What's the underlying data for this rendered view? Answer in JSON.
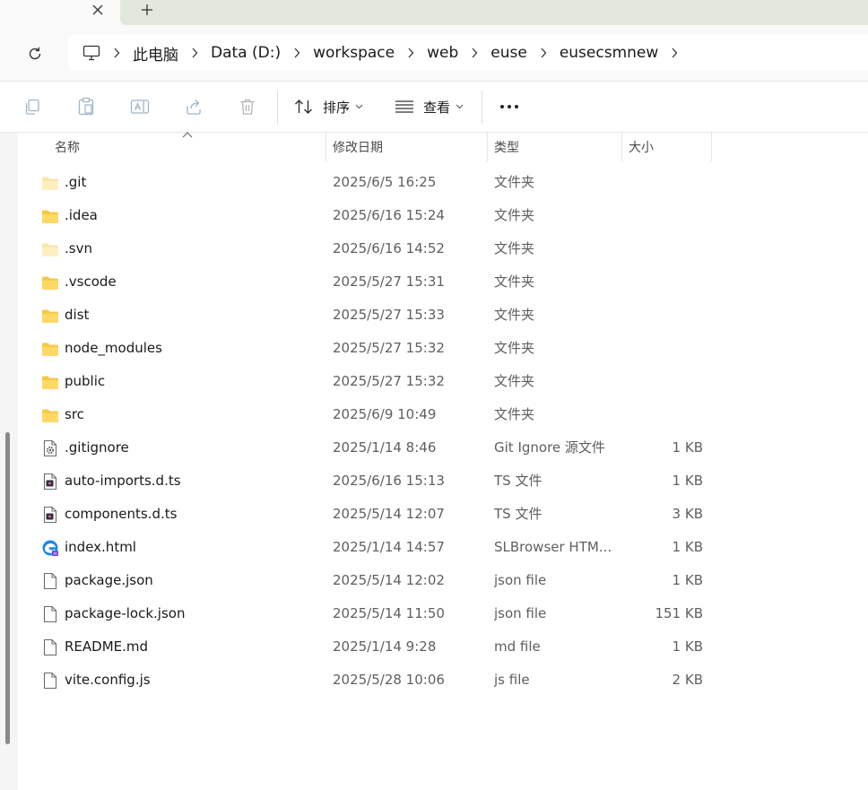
{
  "tabs": {
    "close_glyph": "✕",
    "new_glyph": "+"
  },
  "address": {
    "crumbs": [
      "此电脑",
      "Data (D:)",
      "workspace",
      "web",
      "euse",
      "eusecsmnew"
    ]
  },
  "toolbar": {
    "sort_label": "排序",
    "view_label": "查看",
    "more_glyph": "···"
  },
  "columns": {
    "name": "名称",
    "modified": "修改日期",
    "type": "类型",
    "size": "大小"
  },
  "files": [
    {
      "name": ".git",
      "modified": "2025/6/5 16:25",
      "type": "文件夹",
      "size": "",
      "icon": "folder-faded-icon"
    },
    {
      "name": ".idea",
      "modified": "2025/6/16 15:24",
      "type": "文件夹",
      "size": "",
      "icon": "folder-icon"
    },
    {
      "name": ".svn",
      "modified": "2025/6/16 14:52",
      "type": "文件夹",
      "size": "",
      "icon": "folder-faded-icon"
    },
    {
      "name": ".vscode",
      "modified": "2025/5/27 15:31",
      "type": "文件夹",
      "size": "",
      "icon": "folder-icon"
    },
    {
      "name": "dist",
      "modified": "2025/5/27 15:33",
      "type": "文件夹",
      "size": "",
      "icon": "folder-icon"
    },
    {
      "name": "node_modules",
      "modified": "2025/5/27 15:32",
      "type": "文件夹",
      "size": "",
      "icon": "folder-icon"
    },
    {
      "name": "public",
      "modified": "2025/5/27 15:32",
      "type": "文件夹",
      "size": "",
      "icon": "folder-icon"
    },
    {
      "name": "src",
      "modified": "2025/6/9 10:49",
      "type": "文件夹",
      "size": "",
      "icon": "folder-icon"
    },
    {
      "name": ".gitignore",
      "modified": "2025/1/14 8:46",
      "type": "Git Ignore 源文件",
      "size": "1 KB",
      "icon": "gear-file-icon"
    },
    {
      "name": "auto-imports.d.ts",
      "modified": "2025/6/16 15:13",
      "type": "TS 文件",
      "size": "1 KB",
      "icon": "ts-file-icon"
    },
    {
      "name": "components.d.ts",
      "modified": "2025/5/14 12:07",
      "type": "TS 文件",
      "size": "3 KB",
      "icon": "ts-file-icon"
    },
    {
      "name": "index.html",
      "modified": "2025/1/14 14:57",
      "type": "SLBrowser HTM...",
      "size": "1 KB",
      "icon": "browser-icon"
    },
    {
      "name": "package.json",
      "modified": "2025/5/14 12:02",
      "type": "json file",
      "size": "1 KB",
      "icon": "file-icon"
    },
    {
      "name": "package-lock.json",
      "modified": "2025/5/14 11:50",
      "type": "json file",
      "size": "151 KB",
      "icon": "file-icon"
    },
    {
      "name": "README.md",
      "modified": "2025/1/14 9:28",
      "type": "md file",
      "size": "1 KB",
      "icon": "file-icon"
    },
    {
      "name": "vite.config.js",
      "modified": "2025/5/28 10:06",
      "type": "js file",
      "size": "2 KB",
      "icon": "file-icon"
    }
  ],
  "colors": {
    "folder": "#f7c948",
    "folder_faded": "#fbe6a6",
    "accent": "#0067c0"
  }
}
